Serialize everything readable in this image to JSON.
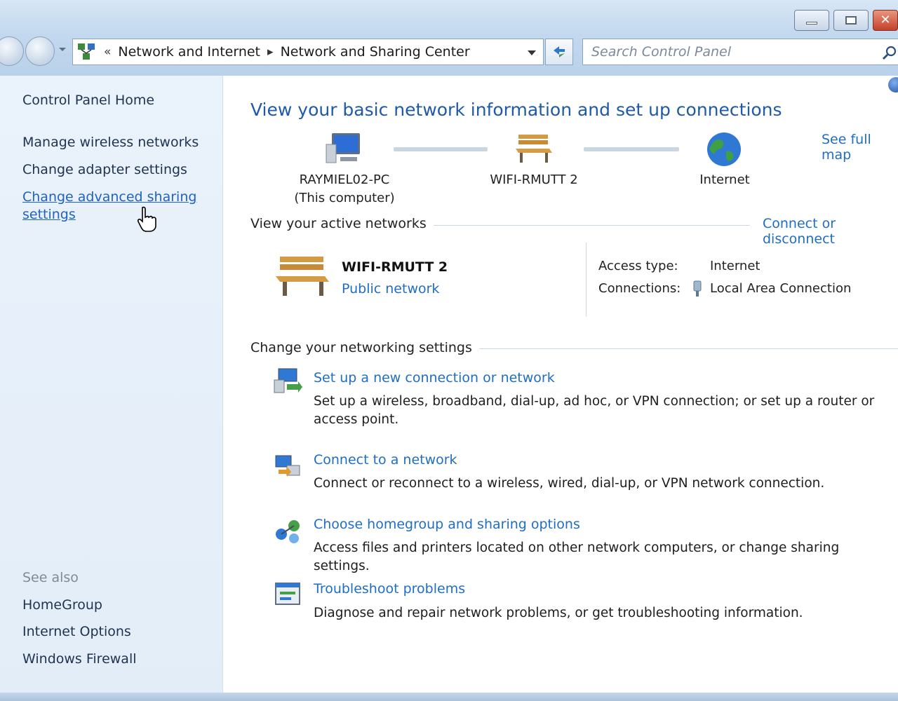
{
  "window": {
    "buttons": [
      "minimize",
      "maximize",
      "close"
    ]
  },
  "address": {
    "crumb_1": "Network and Internet",
    "crumb_2": "Network and Sharing Center",
    "chevrons": "«",
    "arrow": "▸"
  },
  "search": {
    "placeholder": "Search Control Panel"
  },
  "sidebar": {
    "home": "Control Panel Home",
    "items": [
      {
        "label": "Manage wireless networks"
      },
      {
        "label": "Change adapter settings"
      },
      {
        "label_line1": "Change advanced sharing",
        "label_line2": "settings"
      }
    ],
    "see_also": "See also",
    "see_also_items": [
      {
        "label": "HomeGroup"
      },
      {
        "label": "Internet Options"
      },
      {
        "label": "Windows Firewall"
      }
    ]
  },
  "main": {
    "title": "View your basic network information and set up connections",
    "see_full_map": "See full map",
    "map": {
      "computer_line1": "RAYMIEL02-PC",
      "computer_line2": "(This computer)",
      "network": "WIFI-RMUTT  2",
      "internet": "Internet"
    },
    "active_networks": {
      "heading": "View your active networks",
      "connect_link": "Connect or disconnect",
      "name": "WIFI-RMUTT  2",
      "type": "Public network",
      "access_type_label": "Access type:",
      "access_type_value": "Internet",
      "connections_label": "Connections:",
      "connections_value": "Local Area Connection"
    },
    "settings": {
      "heading": "Change your networking settings",
      "tasks": [
        {
          "title": "Set up a new connection or network",
          "desc": "Set up a wireless, broadband, dial-up, ad hoc, or VPN connection; or set up a router or access point.",
          "icon": "new-connection-icon"
        },
        {
          "title": "Connect to a network",
          "desc": "Connect or reconnect to a wireless, wired, dial-up, or VPN network connection.",
          "icon": "connect-network-icon"
        },
        {
          "title": "Choose homegroup and sharing options",
          "desc": "Access files and printers located on other network computers, or change sharing settings.",
          "icon": "homegroup-icon"
        },
        {
          "title": "Troubleshoot problems",
          "desc": "Diagnose and repair network problems, or get troubleshooting information.",
          "icon": "troubleshoot-icon"
        }
      ]
    }
  },
  "colors": {
    "link": "#1f6dc5",
    "title": "#1e5aa8",
    "sidebar_bg": "#e6eff9"
  }
}
